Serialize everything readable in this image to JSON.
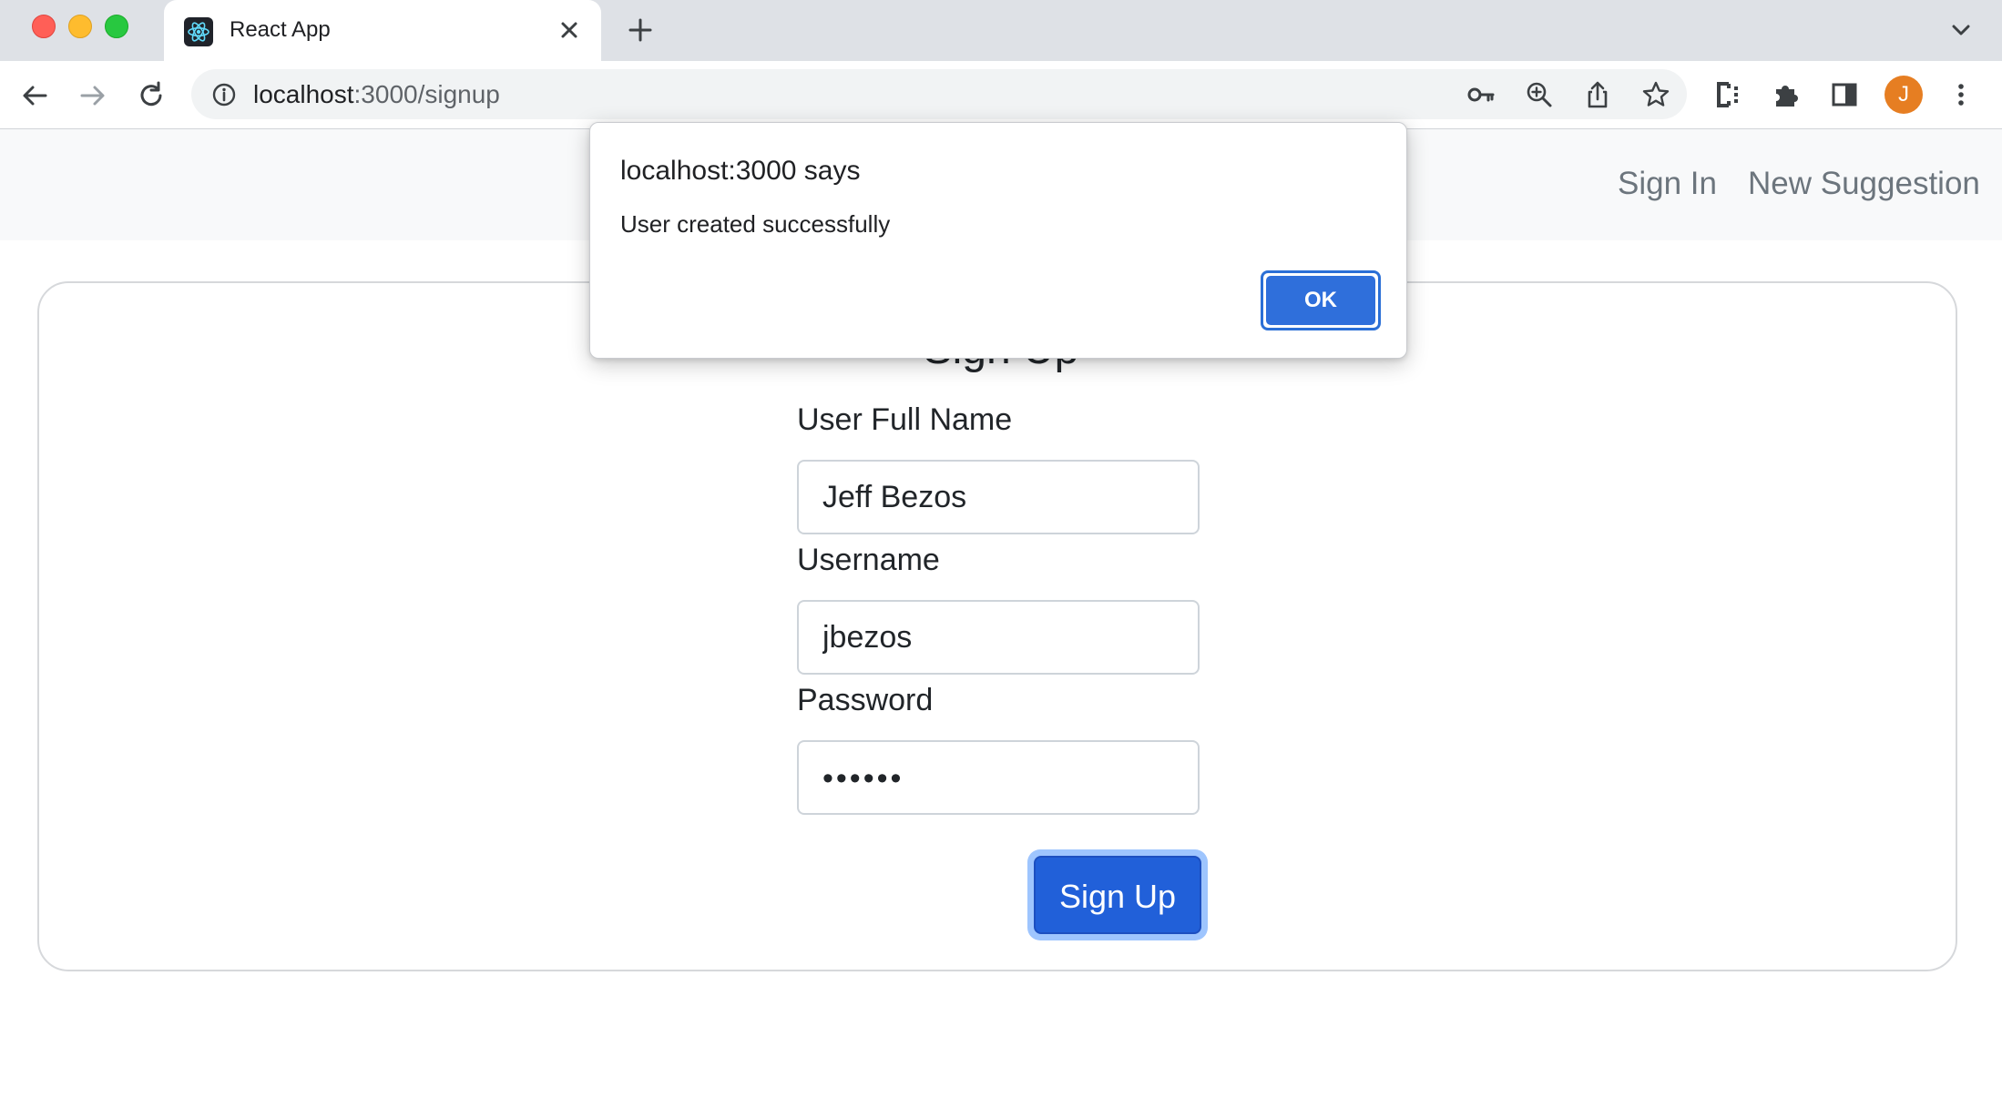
{
  "browser": {
    "tab_title": "React App",
    "url_host": "localhost",
    "url_path": ":3000/signup",
    "profile_initial": "J",
    "icons": [
      "react-favicon-icon",
      "close-icon",
      "plus-icon",
      "chevron-down-icon",
      "back-arrow-icon",
      "forward-arrow-icon",
      "reload-icon",
      "info-icon",
      "key-icon",
      "zoom-icon",
      "share-icon",
      "star-icon",
      "extension-c-icon",
      "puzzle-icon",
      "side-panel-icon",
      "more-vert-icon"
    ]
  },
  "navbar": {
    "links": [
      "Sign In",
      "New Suggestion"
    ]
  },
  "form": {
    "title": "Sign Up",
    "full_name_label": "User Full Name",
    "full_name_value": "Jeff Bezos",
    "username_label": "Username",
    "username_value": "jbezos",
    "password_label": "Password",
    "password_mask": "••••••",
    "submit_label": "Sign Up"
  },
  "dialog": {
    "title": "localhost:3000 says",
    "message": "User created successfully",
    "ok_label": "OK"
  },
  "colors": {
    "primary": "#2160d9",
    "dialog_ok": "#2f6fdb",
    "avatar": "#e67e22",
    "navbar_bg": "#f8f9fa"
  }
}
